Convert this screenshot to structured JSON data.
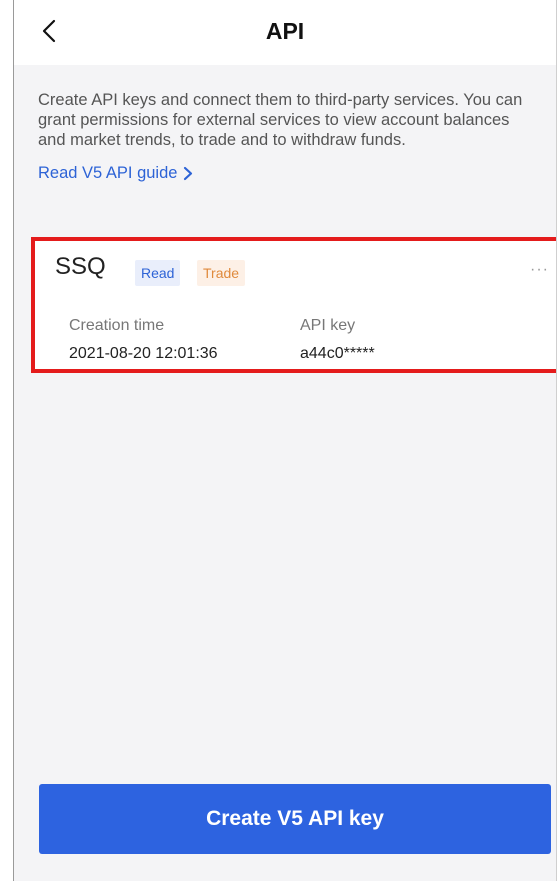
{
  "header": {
    "title": "API",
    "back_icon": "chevron-left-icon"
  },
  "intro": {
    "description": "Create API keys and connect them to third-party services. You can grant permissions for external services to view account balances and market trends, to trade and to withdraw funds.",
    "guide_link": "Read V5 API guide"
  },
  "api_keys": [
    {
      "name": "SSQ",
      "badges": [
        "Read",
        "Trade"
      ],
      "more_icon": "more-dots-icon",
      "creation_time_label": "Creation time",
      "creation_time": "2021-08-20 12:01:36",
      "api_key_label": "API key",
      "api_key": "a44c0*****"
    }
  ],
  "footer": {
    "create_button": "Create V5 API key"
  },
  "colors": {
    "accent": "#2d63e0",
    "highlight": "#e41b1b",
    "read_badge": "#2d63d6",
    "trade_badge": "#e08a3c"
  }
}
